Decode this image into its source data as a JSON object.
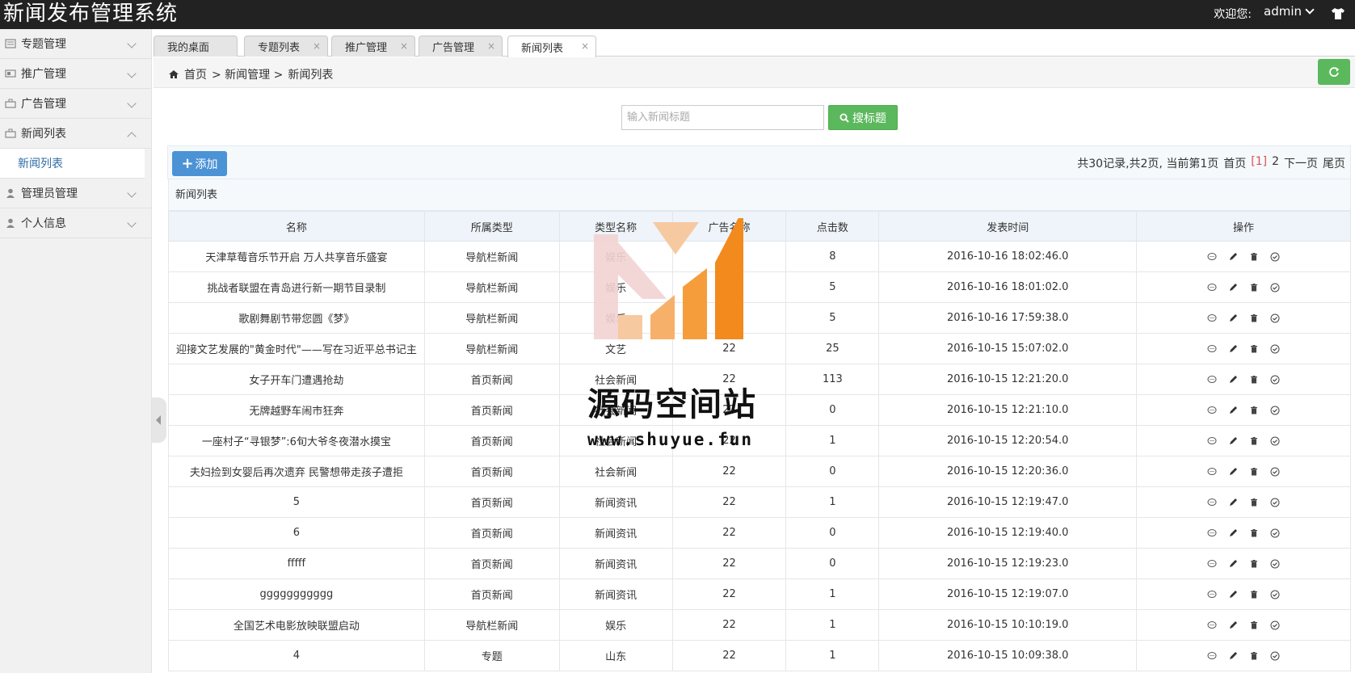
{
  "header": {
    "app_title": "新闻发布管理系统",
    "welcome": "欢迎您:",
    "username": "admin"
  },
  "sidebar": {
    "items": [
      {
        "label": "专题管理",
        "icon": "list-icon"
      },
      {
        "label": "推广管理",
        "icon": "card-icon"
      },
      {
        "label": "广告管理",
        "icon": "briefcase-icon"
      },
      {
        "label": "新闻列表",
        "icon": "briefcase-icon",
        "expanded": true
      },
      {
        "label": "管理员管理",
        "icon": "user-icon"
      },
      {
        "label": "个人信息",
        "icon": "user-icon"
      }
    ],
    "sub_item": "新闻列表"
  },
  "tabs": [
    {
      "label": "我的桌面",
      "closable": false
    },
    {
      "label": "专题列表",
      "closable": true
    },
    {
      "label": "推广管理",
      "closable": true
    },
    {
      "label": "广告管理",
      "closable": true
    },
    {
      "label": "新闻列表",
      "closable": true,
      "active": true
    }
  ],
  "breadcrumb": {
    "home": "首页",
    "level1": "> 新闻管理 >",
    "level2": "新闻列表"
  },
  "search": {
    "placeholder": "输入新闻标题",
    "button_label": "搜标题"
  },
  "toolbar": {
    "add_label": "添加",
    "pager": {
      "summary": "共30记录,共2页, 当前第1页",
      "first": "首页",
      "current": "[1]",
      "next_page_num": "2",
      "next": "下一页",
      "last": "尾页"
    }
  },
  "table": {
    "caption": "新闻列表",
    "headers": [
      "名称",
      "所属类型",
      "类型名称",
      "广告名称",
      "点击数",
      "发表时间",
      "操作"
    ],
    "rows": [
      [
        "天津草莓音乐节开启 万人共享音乐盛宴",
        "导航栏新闻",
        "娱乐",
        "22",
        "8",
        "2016-10-16 18:02:46.0"
      ],
      [
        "挑战者联盟在青岛进行新一期节目录制",
        "导航栏新闻",
        "娱乐",
        "22",
        "5",
        "2016-10-16 18:01:02.0"
      ],
      [
        "歌剧舞剧节带您圆《梦》",
        "导航栏新闻",
        "娱乐",
        "22",
        "5",
        "2016-10-16 17:59:38.0"
      ],
      [
        "迎接文艺发展的\"黄金时代\"——写在习近平总书记主",
        "导航栏新闻",
        "文艺",
        "22",
        "25",
        "2016-10-15 15:07:02.0"
      ],
      [
        "女子开车门遭遇抢劫",
        "首页新闻",
        "社会新闻",
        "22",
        "113",
        "2016-10-15 12:21:20.0"
      ],
      [
        "无牌越野车闹市狂奔",
        "首页新闻",
        "社会新闻",
        "22",
        "0",
        "2016-10-15 12:21:10.0"
      ],
      [
        "一座村子“寻银梦”:6旬大爷冬夜潜水摸宝",
        "首页新闻",
        "社会新闻",
        "22",
        "1",
        "2016-10-15 12:20:54.0"
      ],
      [
        "夫妇捡到女婴后再次遗弃 民警想带走孩子遭拒",
        "首页新闻",
        "社会新闻",
        "22",
        "0",
        "2016-10-15 12:20:36.0"
      ],
      [
        "5",
        "首页新闻",
        "新闻资讯",
        "22",
        "1",
        "2016-10-15 12:19:47.0"
      ],
      [
        "6",
        "首页新闻",
        "新闻资讯",
        "22",
        "0",
        "2016-10-15 12:19:40.0"
      ],
      [
        "fffff",
        "首页新闻",
        "新闻资讯",
        "22",
        "0",
        "2016-10-15 12:19:23.0"
      ],
      [
        "ggggggggggg",
        "首页新闻",
        "新闻资讯",
        "22",
        "1",
        "2016-10-15 12:19:07.0"
      ],
      [
        "全国艺术电影放映联盟启动",
        "导航栏新闻",
        "娱乐",
        "22",
        "1",
        "2016-10-15 10:10:19.0"
      ],
      [
        "4",
        "专题",
        "山东",
        "22",
        "1",
        "2016-10-15 10:09:38.0"
      ]
    ]
  },
  "watermark": {
    "title": "源码空间站",
    "url": "www.shuyue.fun"
  },
  "colors": {
    "header_bg": "#222222",
    "success": "#5cb85c",
    "primary": "#4c93d6",
    "sidebar_bg": "#f1f1f1",
    "pager_current": "#d9534f",
    "watermark_orange": "#f28a1e"
  }
}
